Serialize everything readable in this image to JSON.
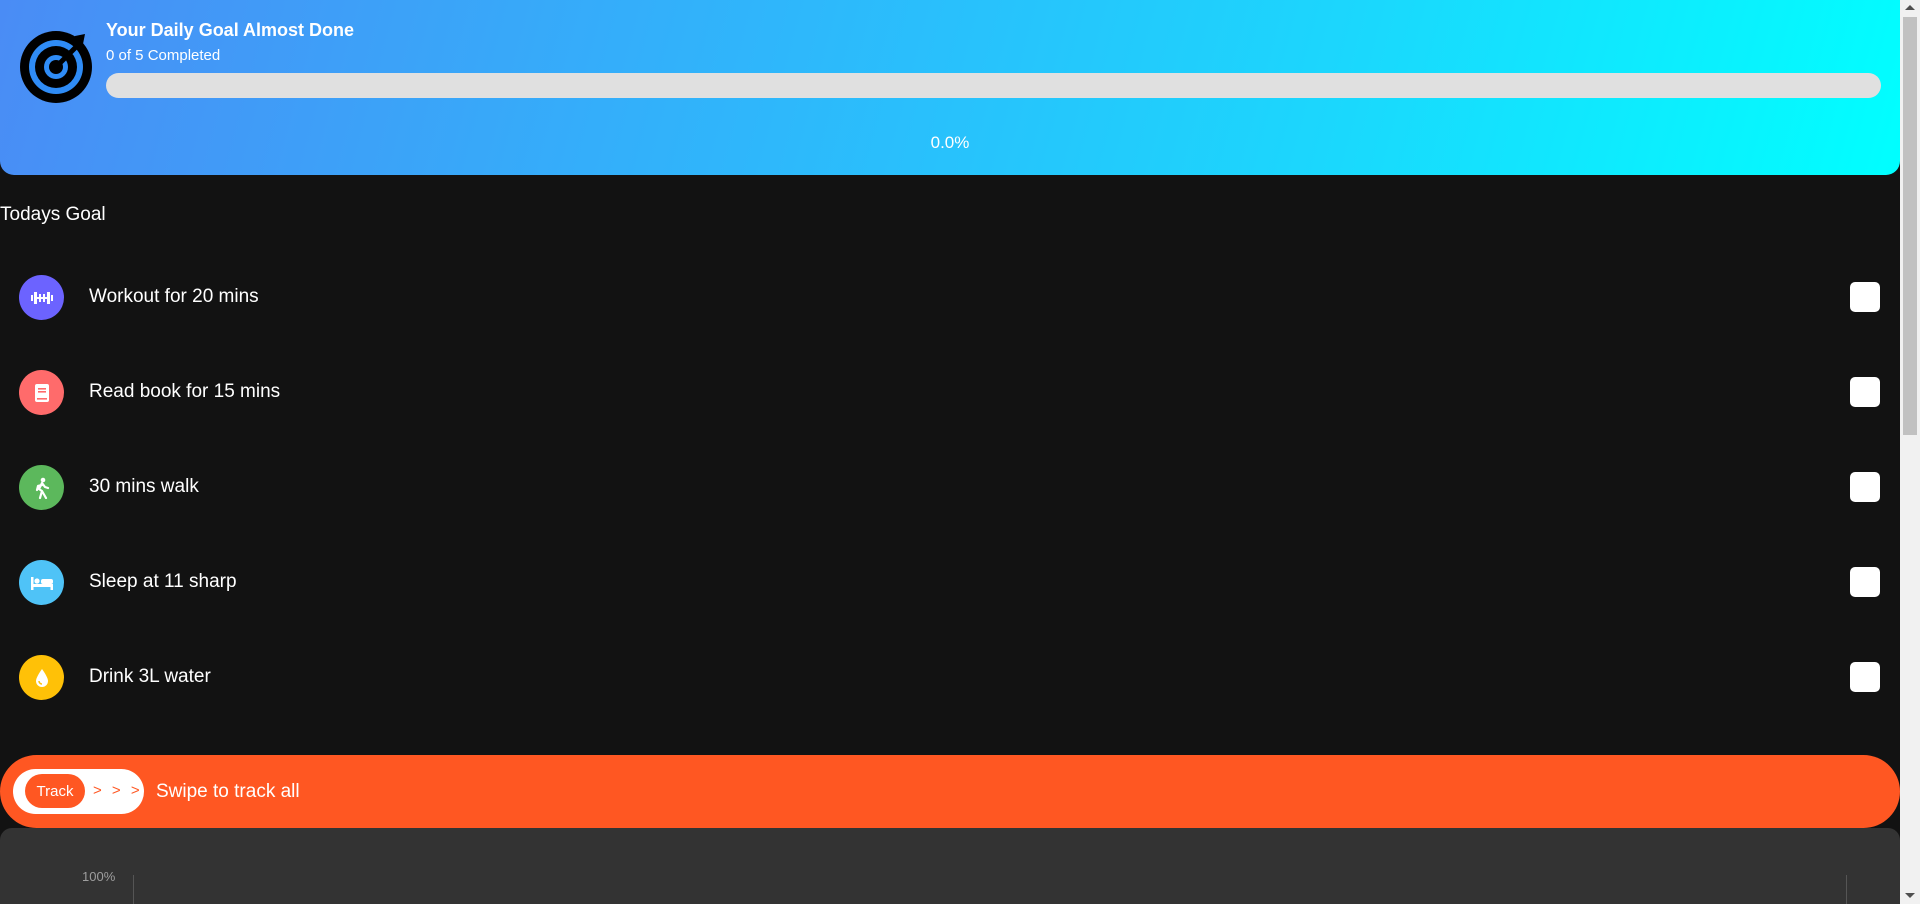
{
  "header": {
    "title": "Your Daily Goal Almost Done",
    "subtitle": "0 of 5 Completed",
    "progress_percent": 0,
    "progress_label": "0.0%",
    "icon": "target-icon"
  },
  "section_title": "Todays Goal",
  "goals": [
    {
      "label": "Workout for 20 mins",
      "icon": "dumbbell-icon",
      "color": "#6c63ff",
      "checked": false
    },
    {
      "label": "Read book for 15 mins",
      "icon": "book-icon",
      "color": "#ff6b6b",
      "checked": false
    },
    {
      "label": "30 mins walk",
      "icon": "walk-icon",
      "color": "#5cb85c",
      "checked": false
    },
    {
      "label": "Sleep at 11 sharp",
      "icon": "bed-icon",
      "color": "#4fc3f7",
      "checked": false
    },
    {
      "label": "Drink 3L water",
      "icon": "water-drop-icon",
      "color": "#ffc107",
      "checked": false
    }
  ],
  "swipe": {
    "handle_label": "Track",
    "arrows": "> > >",
    "text": "Swipe to track all",
    "color": "#ff5722"
  },
  "chart": {
    "y_tick": "100%"
  }
}
